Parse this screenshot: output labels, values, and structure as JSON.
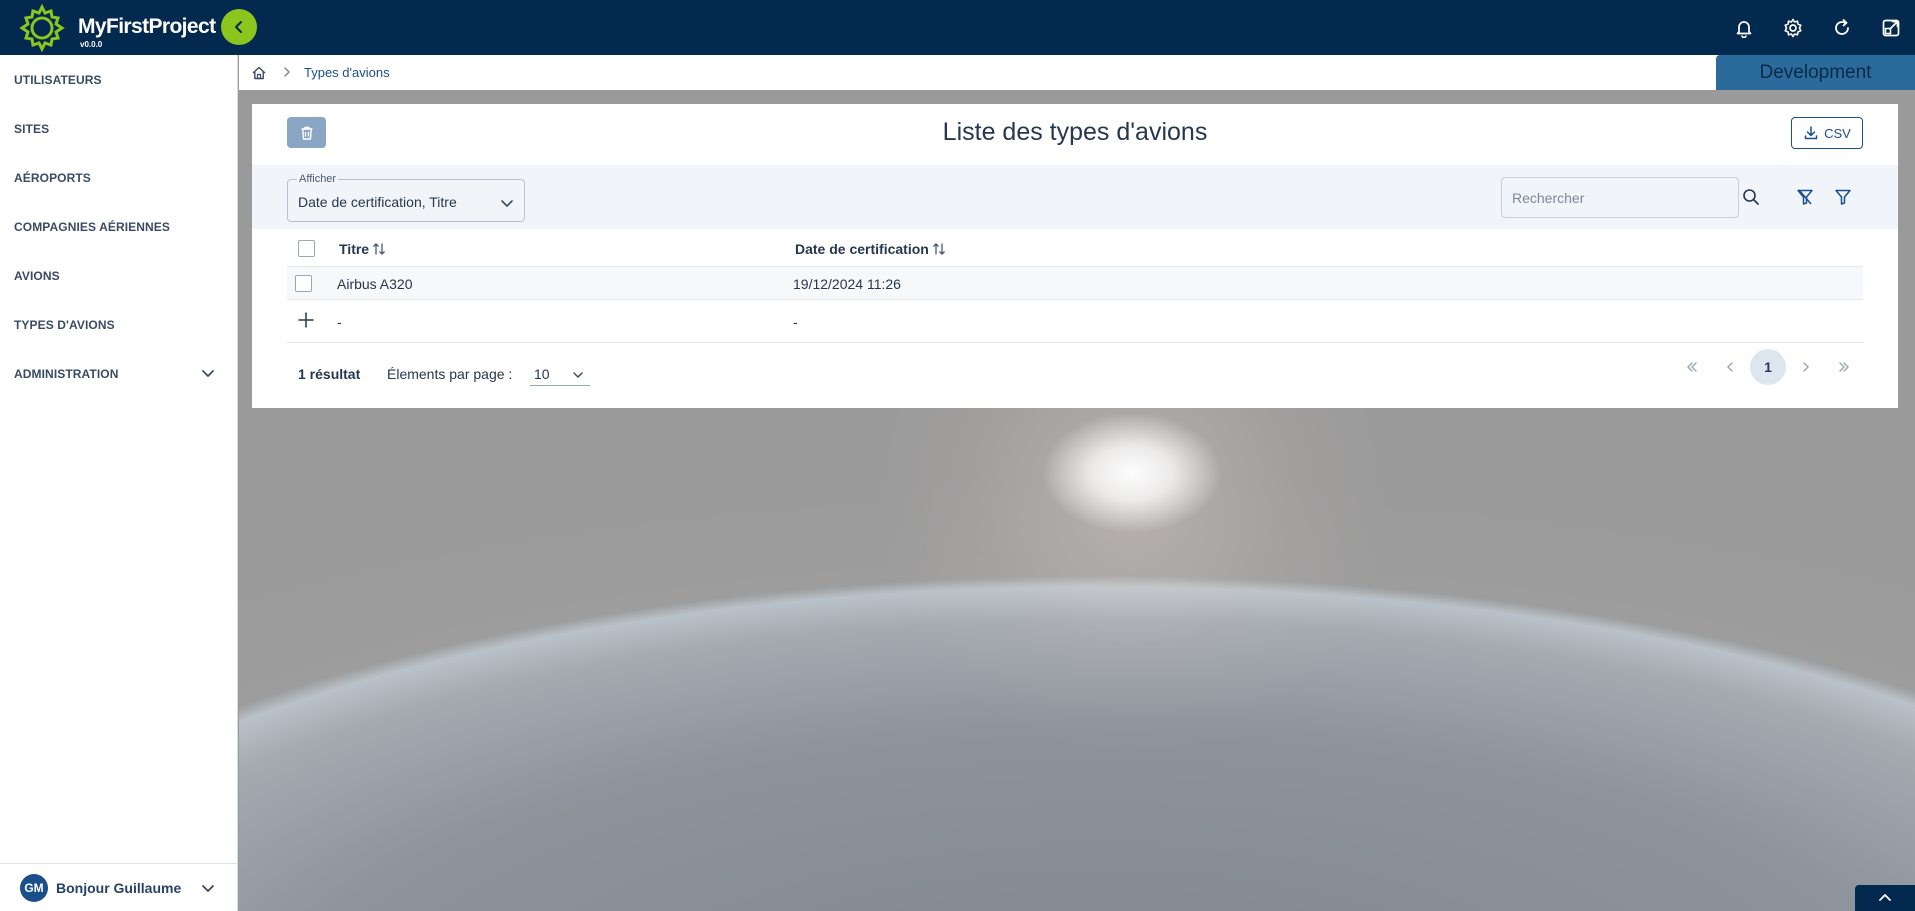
{
  "app": {
    "name": "MyFirstProject",
    "version": "v0.0.0",
    "environment": "Development"
  },
  "colors": {
    "header": "#04294f",
    "accent": "#8bc61f",
    "primary": "#1a4f8b",
    "environment_badge": "#2a6b9c"
  },
  "topbar": {
    "icons": [
      "bell-icon",
      "gear-icon",
      "refresh-icon",
      "external-link-icon"
    ]
  },
  "sidebar": {
    "items": [
      {
        "label": "UTILISATEURS"
      },
      {
        "label": "SITES"
      },
      {
        "label": "AÉROPORTS"
      },
      {
        "label": "COMPAGNIES AÉRIENNES"
      },
      {
        "label": "AVIONS"
      },
      {
        "label": "TYPES D'AVIONS"
      },
      {
        "label": "ADMINISTRATION"
      }
    ],
    "user": {
      "initials": "GM",
      "greeting": "Bonjour Guillaume"
    }
  },
  "breadcrumb": {
    "current": "Types d'avions"
  },
  "panel": {
    "title": "Liste des types d'avions",
    "csv_label": "CSV",
    "display_select": {
      "label": "Afficher",
      "value": "Date de certification, Titre"
    },
    "search": {
      "placeholder": "Rechercher"
    },
    "columns": [
      "Titre",
      "Date de certification"
    ],
    "rows": [
      {
        "titre": "Airbus A320",
        "date": "19/12/2024 11:26"
      }
    ],
    "new_row": {
      "titre": "-",
      "date": "-"
    },
    "footer": {
      "result_count": "1 résultat",
      "per_page_label": "Élements par page :",
      "per_page_value": "10",
      "current_page": "1"
    }
  }
}
